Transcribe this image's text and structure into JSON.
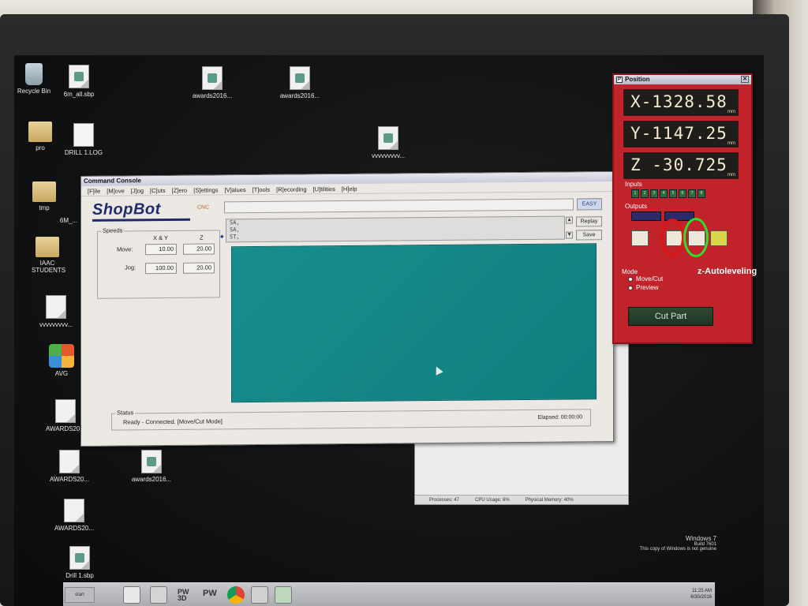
{
  "desktop_icons": [
    {
      "label": "Recycle Bin",
      "icon": "recycle-bin-icon"
    },
    {
      "label": "6m_all.sbp",
      "icon": "sbp-file-icon"
    },
    {
      "label": "awards2016...",
      "icon": "sbp-file-icon"
    },
    {
      "label": "awards2016...",
      "icon": "sbp-file-icon"
    },
    {
      "label": "pro",
      "icon": "folder-icon"
    },
    {
      "label": "DRILL 1.LOG",
      "icon": "log-file-icon"
    },
    {
      "label": "vvvvvvvvv...",
      "icon": "sbp-file-icon"
    },
    {
      "label": "tmp",
      "icon": "folder-icon"
    },
    {
      "label": "6M_...",
      "icon": "file-icon"
    },
    {
      "label": "IAAC STUDENTS",
      "icon": "folder-icon"
    },
    {
      "label": "vvvvvvvvv...",
      "icon": "file-icon"
    },
    {
      "label": "AVG",
      "icon": "avg-icon"
    },
    {
      "label": "AWARDS20...",
      "icon": "file-icon"
    },
    {
      "label": "AWARDS20...",
      "icon": "file-icon"
    },
    {
      "label": "awards2016...",
      "icon": "sbp-file-icon"
    },
    {
      "label": "AWARDS20...",
      "icon": "file-icon"
    },
    {
      "label": "Drill 1.sbp",
      "icon": "sbp-file-icon"
    }
  ],
  "bg_window": {
    "status": [
      "Processes: 47",
      "CPU Usage: 6%",
      "Physical Memory: 40%"
    ]
  },
  "console": {
    "title": "Command Console",
    "menu": [
      "[F]ile",
      "[M]ove",
      "[J]og",
      "[C]uts",
      "[Z]ero",
      "[S]ettings",
      "[V]alues",
      "[T]ools",
      "[R]ecording",
      "[U]tilities",
      "[H]elp"
    ],
    "logo": "ShopBot",
    "logo_suffix": "CNC",
    "command_value": "",
    "easy_label": "EASY",
    "speeds": {
      "legend": "Speeds",
      "col_xy": "X & Y",
      "col_z": "Z",
      "move_label": "Move:",
      "jog_label": "Jog:",
      "move_xy": "10.00",
      "move_z": "20.00",
      "jog_xy": "100.00",
      "jog_z": "20.00"
    },
    "history": [
      "SA,",
      "SA,",
      "ST,"
    ],
    "replay_label": "Replay",
    "save_label": "Save",
    "status": {
      "legend": "Status",
      "text": "Ready - Connected. [Move/Cut Mode]",
      "elapsed": "Elapsed: 00:00:00"
    },
    "colors": {
      "output_bg": "#178d8d",
      "logo": "#1e2a6e"
    }
  },
  "position": {
    "title": "Position",
    "x": "X-1328.58",
    "y": "Y-1147.25",
    "z": "Z -30.725",
    "unit": "mm",
    "inputs_label": "Inputs",
    "input_leds": [
      "1",
      "2",
      "3",
      "4",
      "5",
      "6",
      "7",
      "8"
    ],
    "outputs_label": "Outputs",
    "mode_label": "Mode",
    "mode_options": [
      "Move/Cut",
      "Preview"
    ],
    "selected_mode": "Move/Cut",
    "cut_part_label": "Cut Part",
    "colors": {
      "panel": "#c02329",
      "readout_text": "#f3ead0"
    }
  },
  "annotation": "z-Autoleveling",
  "watermark": {
    "line1": "Windows 7",
    "line2": "Build 7601",
    "line3": "This copy of Windows is not genuine"
  },
  "taskbar": {
    "start_label": "start",
    "apps": [
      "PW 3D",
      "PW"
    ],
    "time": "11:25 AM",
    "date": "6/30/2016"
  }
}
